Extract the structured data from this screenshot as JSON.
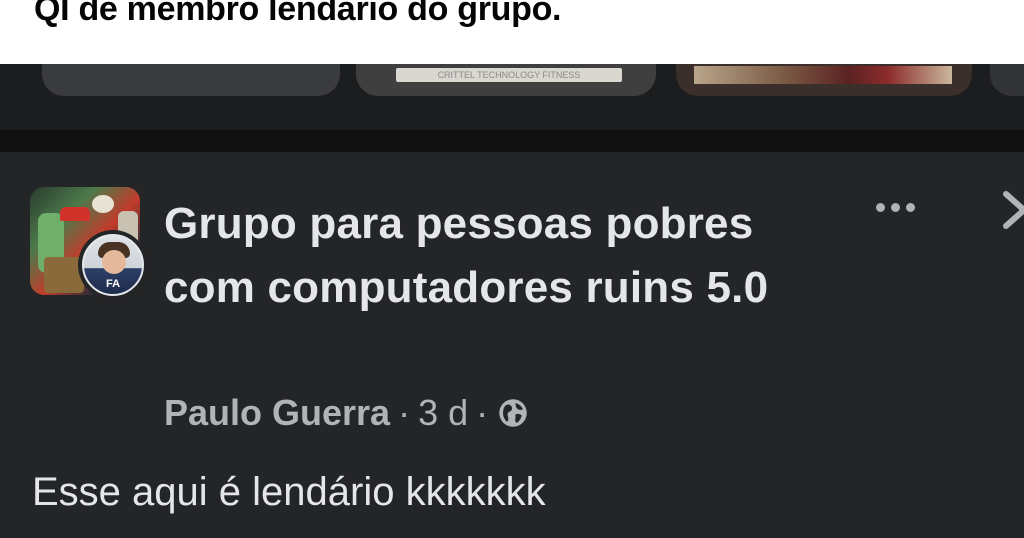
{
  "caption": {
    "text": "QI de membro lendário do grupo."
  },
  "story_cards": {
    "card_2_label": "CRITTEL TECHNOLOGY FITNESS"
  },
  "post": {
    "group_name": "Grupo para pessoas pobres com computadores ruins 5.0",
    "author": "Paulo Guerra",
    "separator": "·",
    "time": "3 d",
    "privacy_icon": "globe-icon",
    "more_icon": "more-options-icon",
    "next_icon": "chevron-right-icon",
    "avatar_shirt_text": "FA",
    "body_text": "Esse aqui é lendário kkkkkkk"
  },
  "colors": {
    "background": "#18191a",
    "post_background": "#242526",
    "primary_text": "#e4e6eb",
    "secondary_text": "#b0b3b8",
    "caption_background": "#ffffff"
  }
}
